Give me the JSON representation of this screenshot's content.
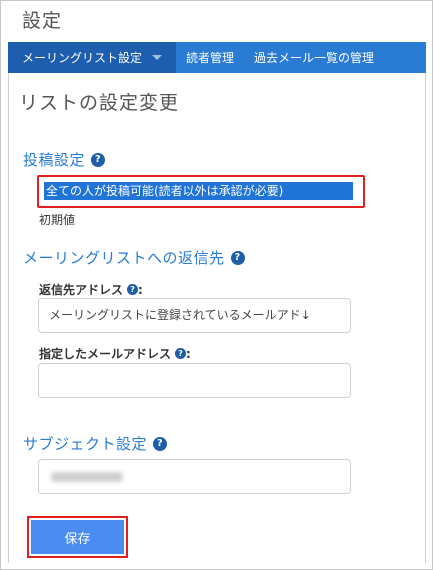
{
  "header": {
    "title": "設定"
  },
  "nav": {
    "items": [
      {
        "label": "メーリングリスト設定"
      },
      {
        "label": "読者管理"
      },
      {
        "label": "過去メール一覧の管理"
      }
    ]
  },
  "main": {
    "title": "リストの設定変更",
    "posting": {
      "title": "投稿設定",
      "selected_option": "全ての人が投稿可能(読者以外は承認が必要)",
      "default_label": "初期値"
    },
    "reply": {
      "title": "メーリングリストへの返信先",
      "reply_to_label": "返信先アドレス",
      "reply_to_value": "メーリングリストに登録されているメールアド↓",
      "specified_label": "指定したメールアドレス",
      "specified_value": ""
    },
    "subject": {
      "title": "サブジェクト設定"
    },
    "save_label": "保存"
  },
  "colors": {
    "nav_bg": "#2a7bd3",
    "accent": "#2a7bd3",
    "highlight": "#e02020",
    "save_button": "#4a8cf0"
  }
}
